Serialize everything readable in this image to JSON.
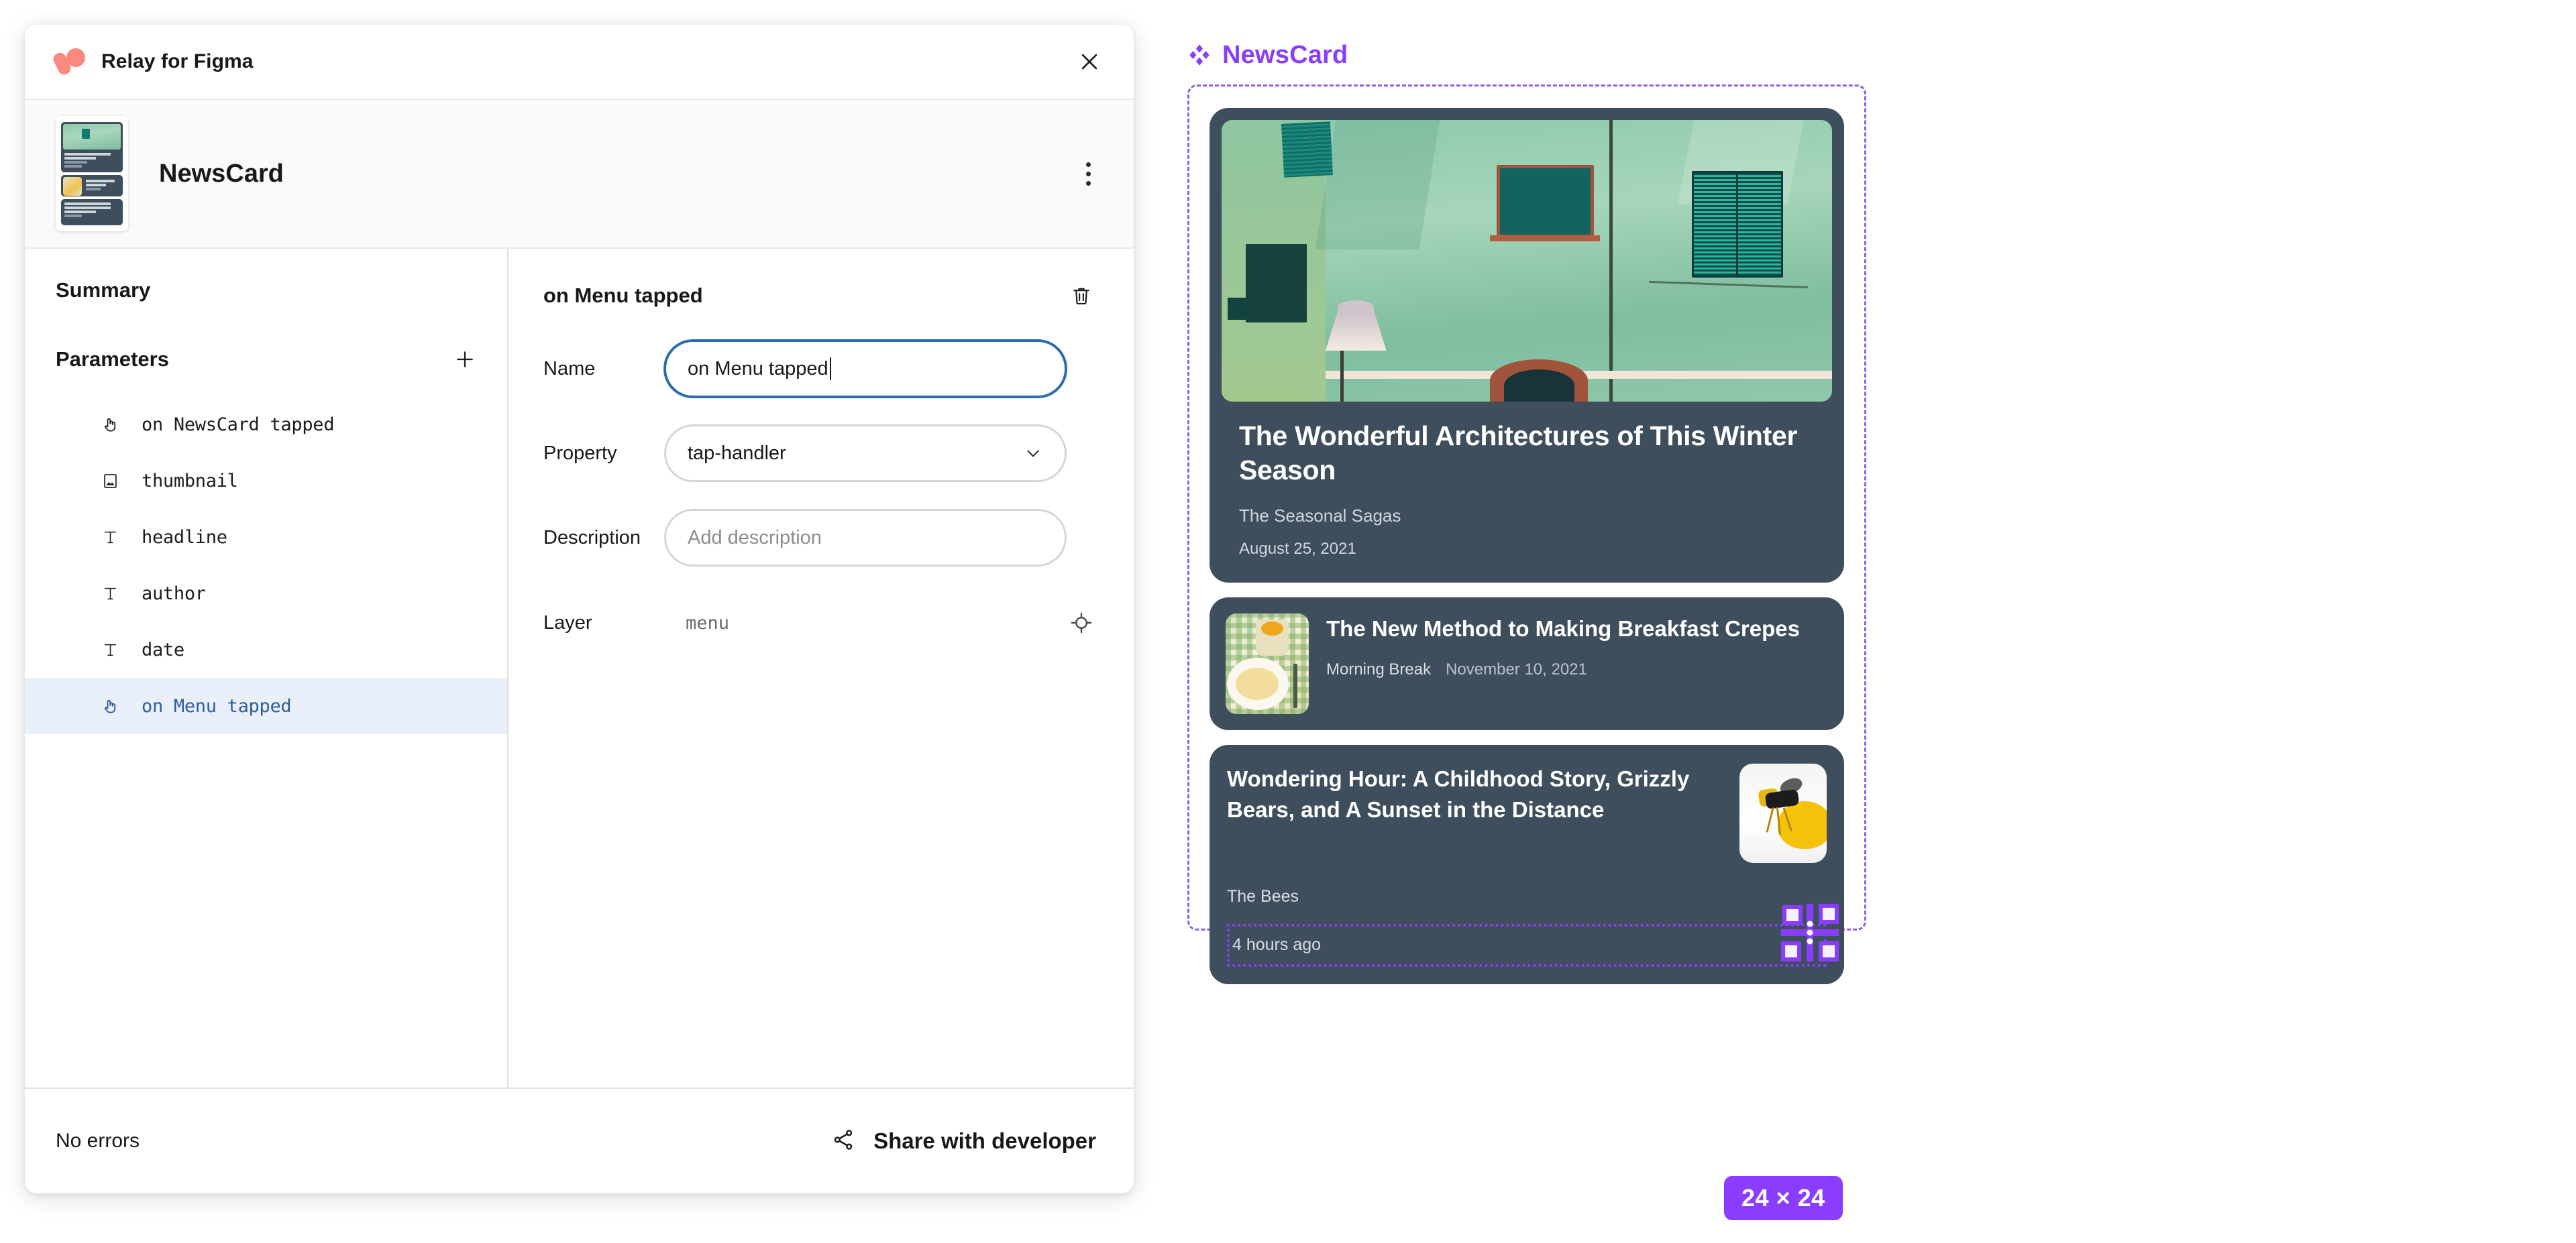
{
  "plugin": {
    "titlebar": {
      "title": "Relay for Figma",
      "logo_icon": "relay-logo-icon",
      "close_icon": "close-icon"
    },
    "component_header": {
      "name": "NewsCard",
      "thumbnail_icon": "component-thumbnail",
      "menu_icon": "kebab-menu-icon"
    },
    "sidebar": {
      "summary_label": "Summary",
      "parameters_label": "Parameters",
      "add_icon": "plus-icon",
      "parameters": [
        {
          "label": "on NewsCard tapped",
          "icon": "tap-handler-icon",
          "selected": false
        },
        {
          "label": "thumbnail",
          "icon": "image-icon",
          "selected": false
        },
        {
          "label": "headline",
          "icon": "text-icon",
          "selected": false
        },
        {
          "label": "author",
          "icon": "text-icon",
          "selected": false
        },
        {
          "label": "date",
          "icon": "text-icon",
          "selected": false
        },
        {
          "label": "on Menu tapped",
          "icon": "tap-handler-icon",
          "selected": true
        }
      ]
    },
    "detail": {
      "title": "on Menu tapped",
      "delete_icon": "trash-icon",
      "name_label": "Name",
      "name_value": "on Menu tapped",
      "property_label": "Property",
      "property_value": "tap-handler",
      "property_chevron_icon": "chevron-down-icon",
      "description_label": "Description",
      "description_value": "",
      "description_placeholder": "Add description",
      "layer_label": "Layer",
      "layer_value": "menu",
      "layer_target_icon": "target-icon"
    },
    "footer": {
      "status": "No errors",
      "share_label": "Share with developer",
      "share_icon": "share-icon"
    }
  },
  "canvas": {
    "component_label": "NewsCard",
    "component_icon": "figma-component-diamond-icon",
    "accent_purple": "#8b3dff",
    "frame_border_color": "#8b5cf6",
    "card_background": "#3e4e5c",
    "size_badge": "24 × 24",
    "cards": [
      {
        "type": "hero",
        "headline": "The Wonderful Architectures of This Winter Season",
        "author": "The Seasonal Sagas",
        "date": "August 25, 2021",
        "image_icon": "green-building-facade-photo"
      },
      {
        "type": "row",
        "headline": "The New Method to Making Breakfast Crepes",
        "author": "Morning Break",
        "date": "November 10, 2021",
        "image_icon": "breakfast-crepes-photo"
      },
      {
        "type": "big",
        "headline": "Wondering Hour: A Childhood Story, Grizzly Bears, and A Sunset in the Distance",
        "author": "The Bees",
        "date": "4 hours ago",
        "image_icon": "bee-photo"
      }
    ]
  }
}
